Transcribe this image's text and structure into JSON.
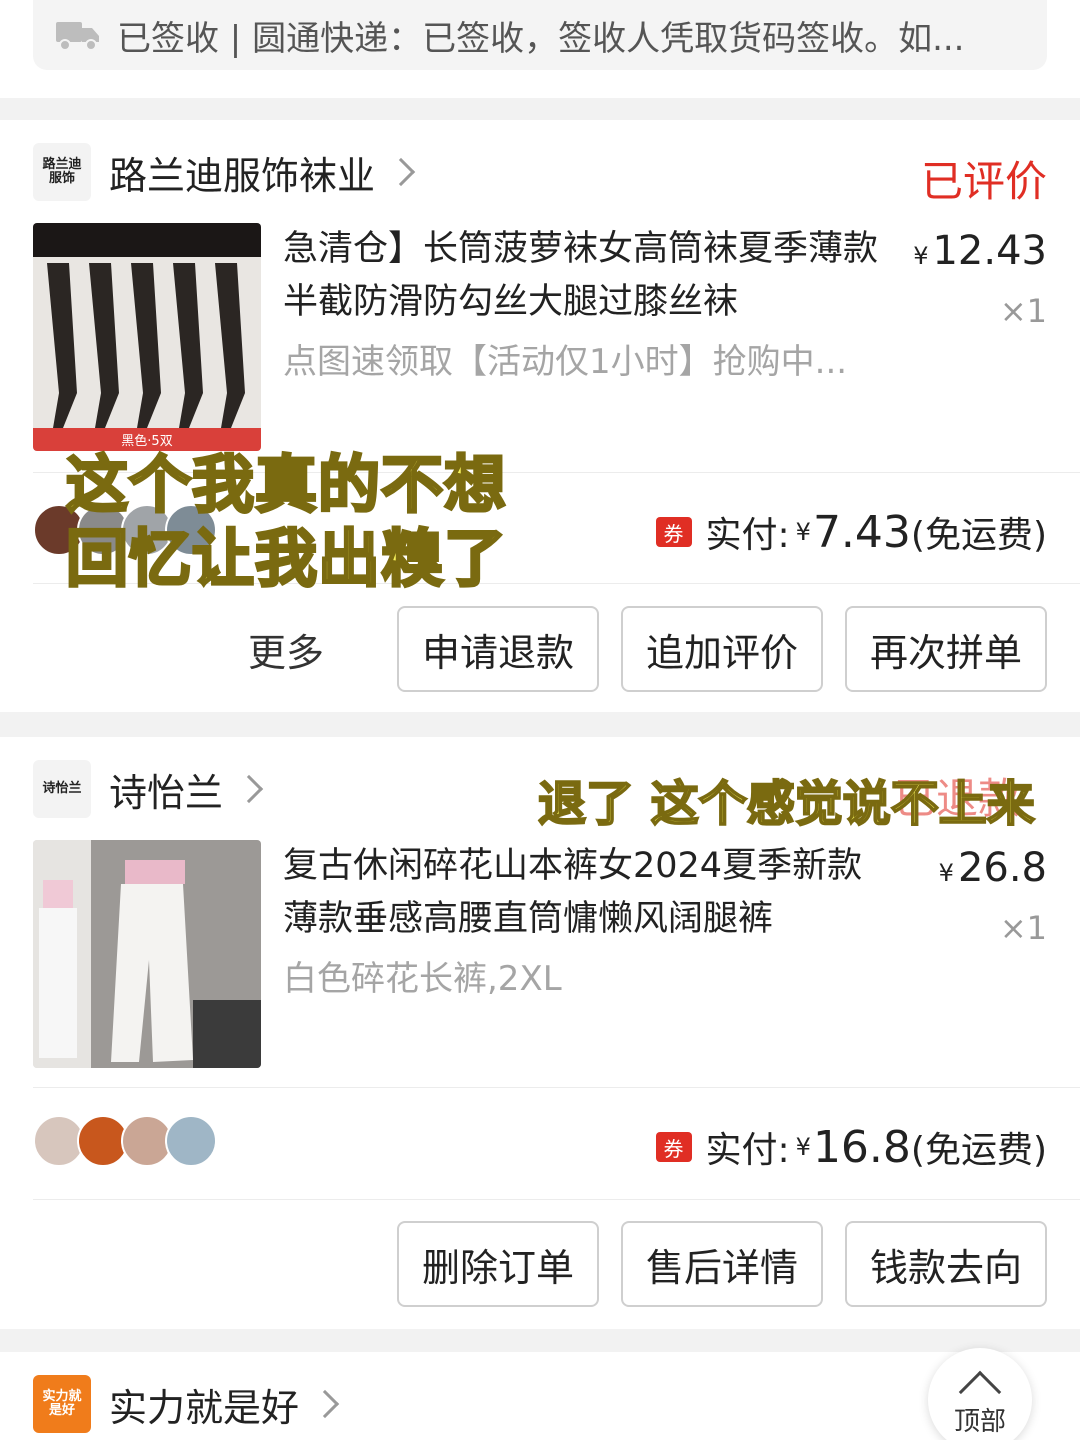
{
  "shipping": {
    "text": "已签收 | 圆通快递：已签收，签收人凭取货码签收。如..."
  },
  "orders": [
    {
      "shop_logo": "路兰迪服饰",
      "shop_name": "路兰迪服饰袜业",
      "status": "已评价",
      "title": "急清仓】长筒菠萝袜女高筒袜夏季薄款半截防滑防勾丝大腿过膝丝袜",
      "spec": "点图速领取【活动仅1小时】抢购中...",
      "image_caption": "黑色·5双",
      "price_symbol": "¥",
      "price": "12.43",
      "qty": "×1",
      "coupon": "券",
      "paid_label": "实付:",
      "paid_symbol": "¥",
      "paid_amount": "7.43",
      "paid_note": "(免运费)",
      "more": "更多",
      "buttons": [
        "申请退款",
        "追加评价",
        "再次拼单"
      ]
    },
    {
      "shop_logo": "诗怡兰",
      "shop_name": "诗怡兰",
      "status": "已退款",
      "title": "复古休闲碎花山本裤女2024夏季新款薄款垂感高腰直筒慵懒风阔腿裤",
      "spec": "白色碎花长裤,2XL",
      "price_symbol": "¥",
      "price": "26.8",
      "qty": "×1",
      "coupon": "券",
      "paid_label": "实付:",
      "paid_symbol": "¥",
      "paid_amount": "16.8",
      "paid_note": "(免运费)",
      "buttons": [
        "删除订单",
        "售后详情",
        "钱款去向"
      ]
    },
    {
      "shop_logo": "实力就是好",
      "shop_name": "实力就是好"
    }
  ],
  "overlays": {
    "comment1_line1": "这个我真的不想",
    "comment1_line2": "回忆让我出糗了",
    "comment2": "退了 这个感觉说不上来"
  },
  "top_button": {
    "label": "顶部"
  },
  "colors": {
    "accent_red": "#e02e24",
    "overlay_yellow": "#f6f15b"
  }
}
